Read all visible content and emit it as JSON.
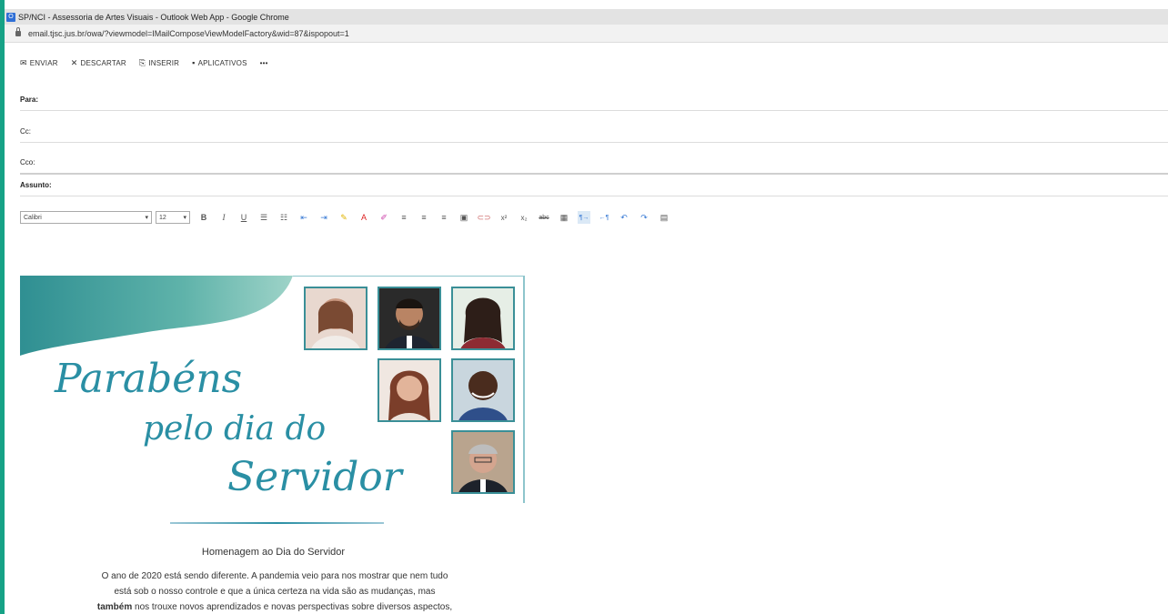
{
  "window": {
    "title": "SP/NCI - Assessoria de Artes Visuais - Outlook Web App - Google Chrome",
    "url": "email.tjsc.jus.br/owa/?viewmodel=IMailComposeViewModelFactory&wid=87&ispopout=1"
  },
  "toolbar": {
    "send": "ENVIAR",
    "discard": "DESCARTAR",
    "insert": "INSERIR",
    "apps": "APLICATIVOS",
    "more": "•••"
  },
  "fields": {
    "to": "Para:",
    "cc": "Cc:",
    "bcc": "Cco:",
    "subject": "Assunto:"
  },
  "format": {
    "font": "Calibri",
    "size": "12"
  },
  "icons": {
    "send": "send-icon",
    "discard": "close-icon",
    "insert": "attach-icon",
    "apps": "apps-icon",
    "bold": "bold-icon",
    "italic": "italic-icon",
    "underline": "underline-icon"
  },
  "card": {
    "title_line1": "Parabéns",
    "title_line2": "pelo dia do",
    "title_line3": "Servidor",
    "subtitle": "Homenagem ao Dia do Servidor",
    "body_line1": "O ano de 2020 está sendo diferente. A pandemia veio para nos mostrar que nem tudo",
    "body_line2": "está sob o nosso controle e que a única certeza na vida são as mudanças, mas",
    "body_line3_bold": "também",
    "body_line3_rest": " nos trouxe novos aprendizados e novas perspectivas sobre diversos aspectos,",
    "accent_color": "#2a8fa4"
  }
}
